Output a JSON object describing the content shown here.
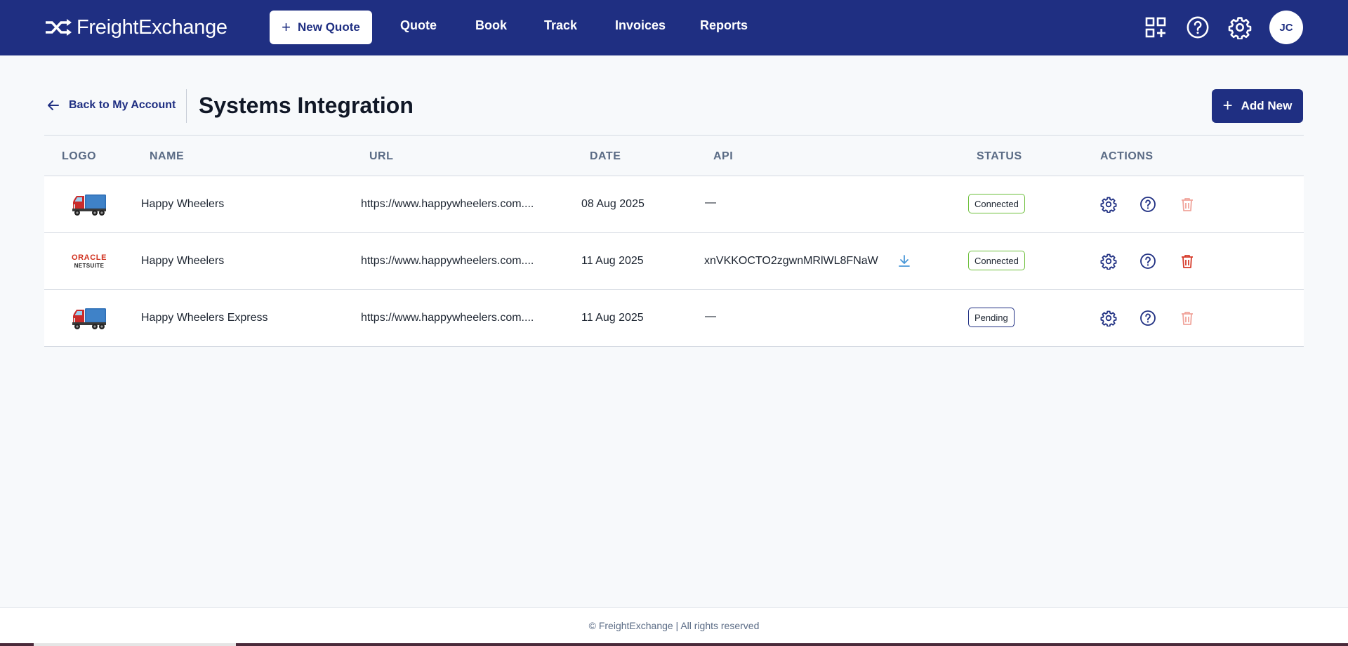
{
  "app": {
    "brand_name": "FreightExchange",
    "colors": {
      "primary": "#1f2f82",
      "connected": "#6cbf3a",
      "delete": "#d63a2a",
      "download": "#4a98d8"
    }
  },
  "nav": {
    "new_quote_label": "New Quote",
    "links": [
      "Quote",
      "Book",
      "Track",
      "Invoices",
      "Reports"
    ],
    "icons": [
      "apps-add-icon",
      "help-icon",
      "settings-icon"
    ],
    "avatar_initials": "JC"
  },
  "page": {
    "back_label": "Back to My Account",
    "title": "Systems Integration",
    "add_new_label": "Add New"
  },
  "table": {
    "columns": [
      "LOGO",
      "NAME",
      "URL",
      "DATE",
      "API",
      "STATUS",
      "ACTIONS"
    ],
    "rows": [
      {
        "logo": "truck-logo",
        "name": "Happy Wheelers",
        "url": "https://www.happywheelers.com....",
        "date": "08 Aug 2025",
        "api": "—",
        "status": "Connected",
        "delete_enabled": false
      },
      {
        "logo": "oracle-netsuite-logo",
        "logo_text": [
          "ORACLE",
          "NETSUITE"
        ],
        "name": "Happy Wheelers",
        "url": "https://www.happywheelers.com....",
        "date": "11 Aug 2025",
        "api": "xnVKKOCTO2zgwnMRlWL8FNaW",
        "status": "Connected",
        "delete_enabled": true
      },
      {
        "logo": "truck-logo",
        "name": "Happy Wheelers Express",
        "url": "https://www.happywheelers.com....",
        "date": "11 Aug 2025",
        "api": "—",
        "status": "Pending",
        "delete_enabled": false
      }
    ]
  },
  "footer": {
    "text": "© FreightExchange | All rights reserved"
  }
}
